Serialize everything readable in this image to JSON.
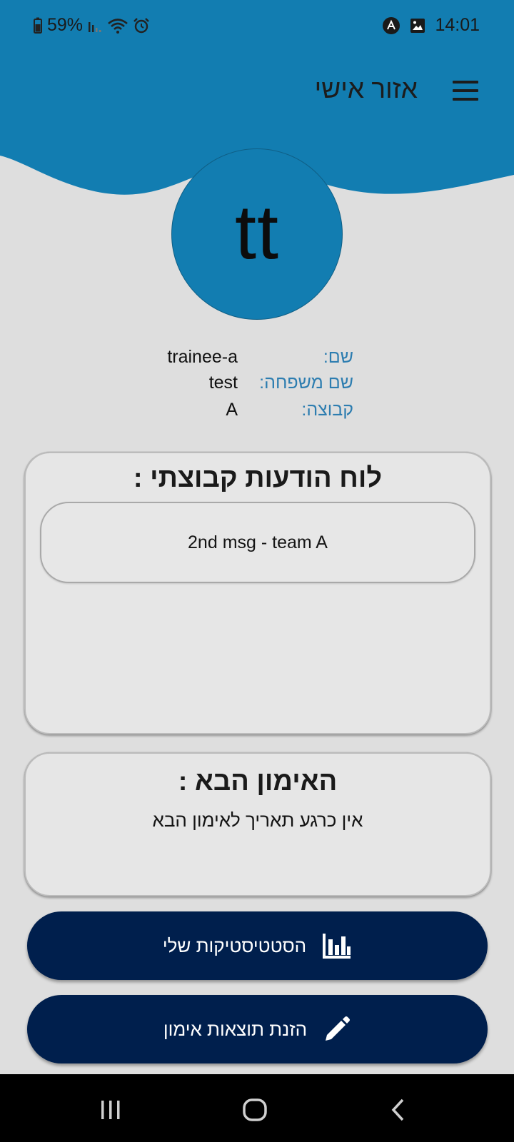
{
  "status_bar": {
    "battery": "59%",
    "time": "14:01",
    "icons": [
      "battery-icon",
      "signal-icon",
      "wifi-icon",
      "alarm-icon",
      "notification-icon",
      "gallery-icon"
    ]
  },
  "header": {
    "title": "אזור אישי",
    "menu_icon": "hamburger-menu-icon",
    "color": "#127db1"
  },
  "profile": {
    "initials": "tt",
    "rows": [
      {
        "label": "שם:",
        "value": "trainee-a"
      },
      {
        "label": "שם משפחה:",
        "value": "test"
      },
      {
        "label": "קבוצה:",
        "value": "A"
      }
    ]
  },
  "board": {
    "title": "לוח הודעות קבוצתי :",
    "messages": [
      "2nd msg - team A"
    ]
  },
  "next_training": {
    "title": "האימון הבא :",
    "text": "אין כרגע תאריך לאימון הבא"
  },
  "buttons": {
    "stats": {
      "label": "הסטטיסטיקות שלי",
      "icon": "bar-chart-icon"
    },
    "enter_results": {
      "label": "הזנת תוצאות אימון",
      "icon": "pencil-icon"
    }
  },
  "colors": {
    "background": "#dedede",
    "button": "#001f4d",
    "label": "#2d7db0"
  },
  "nav": {
    "icons": [
      "recent-apps-icon",
      "home-icon",
      "back-icon"
    ]
  }
}
